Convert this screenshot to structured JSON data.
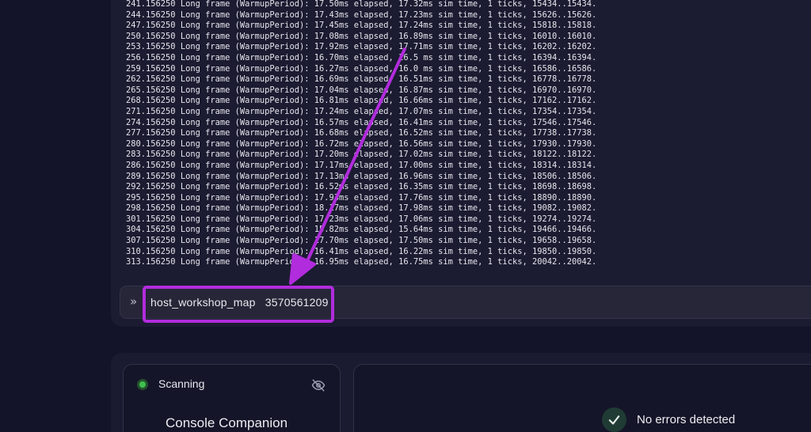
{
  "console": {
    "log_lines": [
      "241.156250 Long frame (WarmupPeriod): 17.50ms elapsed, 17.32ms sim time, 1 ticks, 15434..15434.",
      "244.156250 Long frame (WarmupPeriod): 17.43ms elapsed, 17.23ms sim time, 1 ticks, 15626..15626.",
      "247.156250 Long frame (WarmupPeriod): 17.45ms elapsed, 17.24ms sim time, 1 ticks, 15818..15818.",
      "250.156250 Long frame (WarmupPeriod): 17.08ms elapsed, 16.89ms sim time, 1 ticks, 16010..16010.",
      "253.156250 Long frame (WarmupPeriod): 17.92ms elapsed, 17.71ms sim time, 1 ticks, 16202..16202.",
      "256.156250 Long frame (WarmupPeriod): 16.70ms elapsed, 16.5 ms sim time, 1 ticks, 16394..16394.",
      "259.156250 Long frame (WarmupPeriod): 16.27ms elapsed, 16.0 ms sim time, 1 ticks, 16586..16586.",
      "262.156250 Long frame (WarmupPeriod): 16.69ms elapsed, 16.51ms sim time, 1 ticks, 16778..16778.",
      "265.156250 Long frame (WarmupPeriod): 17.04ms elapsed, 16.87ms sim time, 1 ticks, 16970..16970.",
      "268.156250 Long frame (WarmupPeriod): 16.81ms elapsed, 16.66ms sim time, 1 ticks, 17162..17162.",
      "271.156250 Long frame (WarmupPeriod): 17.24ms elapsed, 17.07ms sim time, 1 ticks, 17354..17354.",
      "274.156250 Long frame (WarmupPeriod): 16.57ms elapsed, 16.41ms sim time, 1 ticks, 17546..17546.",
      "277.156250 Long frame (WarmupPeriod): 16.68ms elapsed, 16.52ms sim time, 1 ticks, 17738..17738.",
      "280.156250 Long frame (WarmupPeriod): 16.72ms elapsed, 16.56ms sim time, 1 ticks, 17930..17930.",
      "283.156250 Long frame (WarmupPeriod): 17.20ms elapsed, 17.02ms sim time, 1 ticks, 18122..18122.",
      "286.156250 Long frame (WarmupPeriod): 17.17ms elapsed, 17.00ms sim time, 1 ticks, 18314..18314.",
      "289.156250 Long frame (WarmupPeriod): 17.13ms elapsed, 16.96ms sim time, 1 ticks, 18506..18506.",
      "292.156250 Long frame (WarmupPeriod): 16.52ms elapsed, 16.35ms sim time, 1 ticks, 18698..18698.",
      "295.156250 Long frame (WarmupPeriod): 17.93ms elapsed, 17.76ms sim time, 1 ticks, 18890..18890.",
      "298.156250 Long frame (WarmupPeriod): 18.17ms elapsed, 17.98ms sim time, 1 ticks, 19082..19082.",
      "301.156250 Long frame (WarmupPeriod): 17.23ms elapsed, 17.06ms sim time, 1 ticks, 19274..19274.",
      "304.156250 Long frame (WarmupPeriod): 15.82ms elapsed, 15.64ms sim time, 1 ticks, 19466..19466.",
      "307.156250 Long frame (WarmupPeriod): 17.70ms elapsed, 17.50ms sim time, 1 ticks, 19658..19658.",
      "310.156250 Long frame (WarmupPeriod): 16.41ms elapsed, 16.22ms sim time, 1 ticks, 19850..19850.",
      "313.156250 Long frame (WarmupPeriod): 16.95ms elapsed, 16.75ms sim time, 1 ticks, 20042..20042."
    ],
    "prompt_icon": "»",
    "command_value": "host_workshop_map  3570561209"
  },
  "annotation": {
    "color": "#b12cdc"
  },
  "scanner": {
    "status_label": "Scanning",
    "status_color": "#3fbf4f",
    "visibility_icon": "eye-off-icon",
    "title": "Console Companion"
  },
  "results": {
    "status_icon": "check-icon",
    "label": "No errors detected"
  }
}
